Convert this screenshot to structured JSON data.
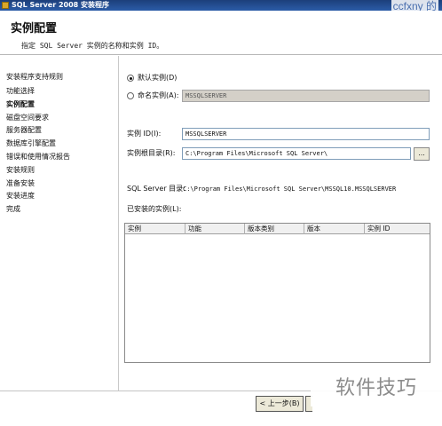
{
  "window": {
    "title": "SQL Server 2008 安装程序"
  },
  "watermarks": {
    "top": "ccfxny 的",
    "bottom": "软件技巧"
  },
  "header": {
    "title": "实例配置",
    "subtitle": "指定 SQL Server 实例的名称和实例 ID。"
  },
  "sidebar": {
    "items": [
      {
        "label": "安装程序支持规则",
        "active": false
      },
      {
        "label": "功能选择",
        "active": false
      },
      {
        "label": "实例配置",
        "active": true
      },
      {
        "label": "磁盘空间要求",
        "active": false
      },
      {
        "label": "服务器配置",
        "active": false
      },
      {
        "label": "数据库引擎配置",
        "active": false
      },
      {
        "label": "错误和使用情况报告",
        "active": false
      },
      {
        "label": "安装规则",
        "active": false
      },
      {
        "label": "准备安装",
        "active": false
      },
      {
        "label": "安装进度",
        "active": false
      },
      {
        "label": "完成",
        "active": false
      }
    ]
  },
  "instance_options": {
    "default_instance_label": "默认实例(D)",
    "default_instance_selected": true,
    "named_instance_label": "命名实例(A):",
    "named_instance_selected": false,
    "named_instance_value": "MSSQLSERVER"
  },
  "fields": {
    "instance_id_label": "实例 ID(I):",
    "instance_id_value": "MSSQLSERVER",
    "root_dir_label": "实例根目录(R):",
    "root_dir_value": "C:\\Program Files\\Microsoft SQL Server\\",
    "browse_label": "..."
  },
  "sql_server_dir": {
    "label": "SQL Server 目录:",
    "value": "C:\\Program Files\\Microsoft SQL Server\\MSSQL10.MSSQLSERVER"
  },
  "installed_instances": {
    "label": "已安装的实例(L):",
    "columns": [
      "实例",
      "功能",
      "版本类别",
      "版本",
      "实例 ID"
    ]
  },
  "footer": {
    "back_label": "< 上一步(B)"
  }
}
